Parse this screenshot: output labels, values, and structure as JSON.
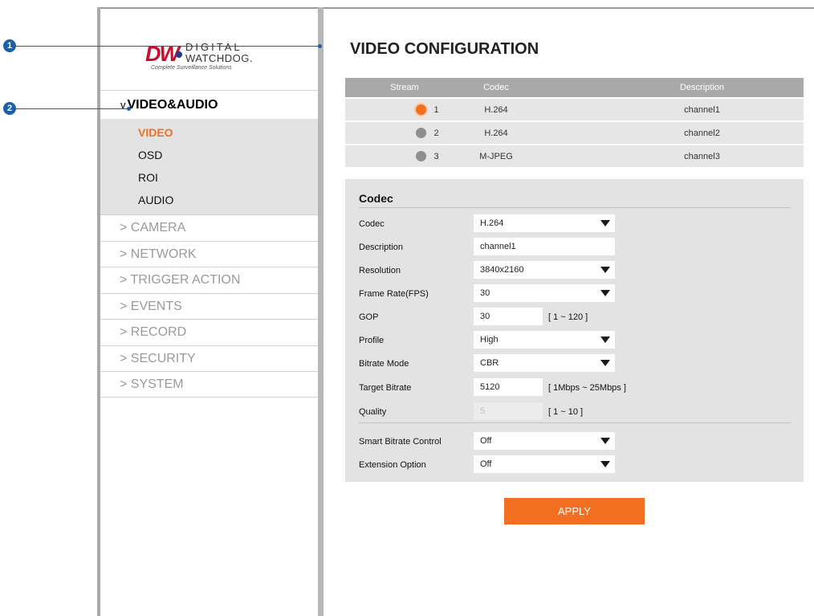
{
  "callouts": [
    "1",
    "2"
  ],
  "logo": {
    "mark": "DW",
    "line1": "DIGITAL",
    "line2": "WATCHDOG.",
    "tagline": "Complete Surveillance Solutions"
  },
  "sidebar": {
    "section": {
      "caret": "v",
      "label": "VIDEO&AUDIO"
    },
    "subitems": [
      {
        "label": "VIDEO",
        "active": true
      },
      {
        "label": "OSD"
      },
      {
        "label": "ROI"
      },
      {
        "label": "AUDIO"
      }
    ],
    "items": [
      {
        "label": "> CAMERA"
      },
      {
        "label": "> NETWORK"
      },
      {
        "label": "> TRIGGER ACTION"
      },
      {
        "label": "> EVENTS"
      },
      {
        "label": "> RECORD"
      },
      {
        "label": "> SECURITY"
      },
      {
        "label": "> SYSTEM"
      }
    ]
  },
  "main": {
    "title": "VIDEO CONFIGURATION",
    "stream_table": {
      "headers": [
        "Stream",
        "Codec",
        "Description"
      ],
      "rows": [
        {
          "stream": "1",
          "codec": "H.264",
          "description": "channel1",
          "selected": true
        },
        {
          "stream": "2",
          "codec": "H.264",
          "description": "channel2",
          "selected": false
        },
        {
          "stream": "3",
          "codec": "M-JPEG",
          "description": "channel3",
          "selected": false
        }
      ]
    },
    "codec_panel": {
      "title": "Codec",
      "fields": {
        "codec": {
          "label": "Codec",
          "value": "H.264"
        },
        "description": {
          "label": "Description",
          "value": "channel1"
        },
        "resolution": {
          "label": "Resolution",
          "value": "3840x2160"
        },
        "frame_rate": {
          "label": "Frame Rate(FPS)",
          "value": "30"
        },
        "gop": {
          "label": "GOP",
          "value": "30",
          "hint": "[ 1 ~ 120 ]"
        },
        "profile": {
          "label": "Profile",
          "value": "High"
        },
        "bitrate_mode": {
          "label": "Bitrate Mode",
          "value": "CBR"
        },
        "target_bitrate": {
          "label": "Target Bitrate",
          "value": "5120",
          "hint": "[ 1Mbps ~ 25Mbps ]"
        },
        "quality": {
          "label": "Quality",
          "value": "5",
          "hint": "[ 1 ~ 10 ]"
        },
        "smart_bitrate": {
          "label": "Smart Bitrate Control",
          "value": "Off"
        },
        "extension": {
          "label": "Extension Option",
          "value": "Off"
        }
      }
    },
    "apply_label": "APPLY"
  }
}
